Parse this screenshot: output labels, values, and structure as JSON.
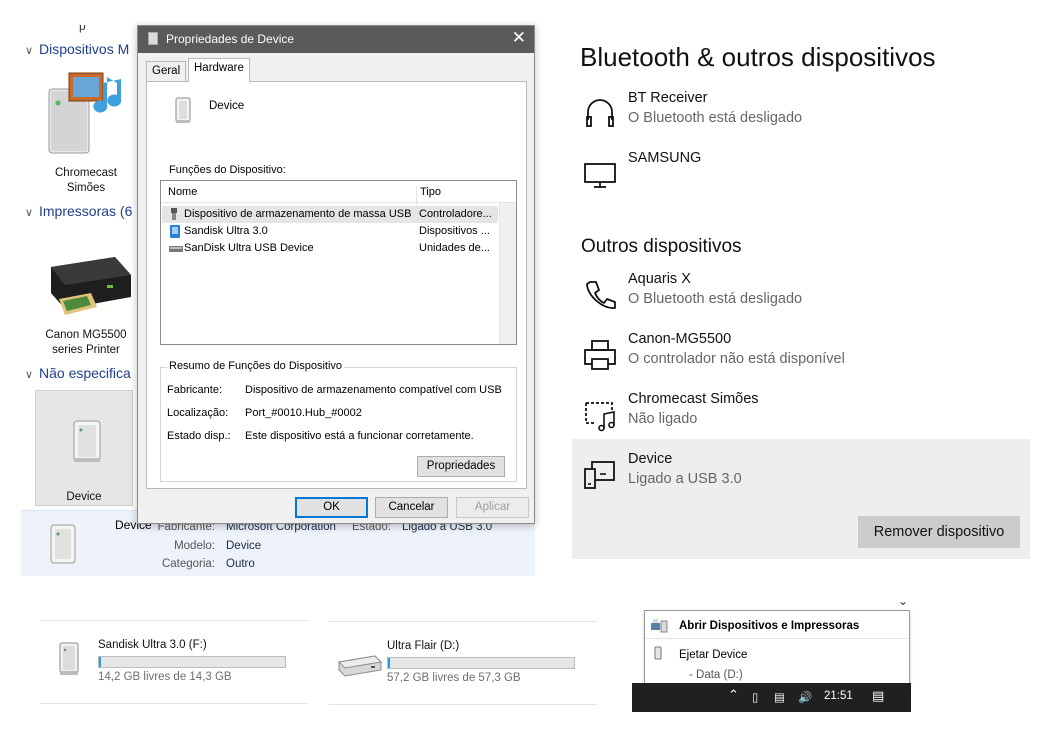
{
  "devices_printers": {
    "top_partial_label": "p",
    "groups": [
      {
        "label": "Dispositivos M"
      },
      {
        "label": "Impressoras (6"
      },
      {
        "label": "Não especifica"
      }
    ],
    "tiles": [
      {
        "label_line1": "Chromecast",
        "label_line2": "Simões"
      },
      {
        "label_line1": "Canon MG5500",
        "label_line2": "series Printer"
      },
      {
        "label_line1": "Device",
        "label_line2": ""
      }
    ],
    "details": {
      "name": "Device",
      "fabricante_key": "Fabricante:",
      "fabricante_value": "Microsoft Corporation",
      "estado_key": "Estado:",
      "estado_value": "Ligado a USB 3.0",
      "modelo_key": "Modelo:",
      "modelo_value": "Device",
      "categoria_key": "Categoria:",
      "categoria_value": "Outro"
    }
  },
  "dialog": {
    "title": "Propriedades de Device",
    "tabs": [
      "Geral",
      "Hardware"
    ],
    "device_name": "Device",
    "functions_label": "Funções do Dispositivo:",
    "columns": [
      "Nome",
      "Tipo"
    ],
    "rows": [
      {
        "name": "Dispositivo de armazenamento de massa USB",
        "type": "Controladore..."
      },
      {
        "name": "Sandisk Ultra 3.0",
        "type": "Dispositivos ..."
      },
      {
        "name": "SanDisk Ultra USB Device",
        "type": "Unidades de..."
      }
    ],
    "summary_title": "Resumo de Funções do Dispositivo",
    "summary": [
      {
        "key": "Fabricante:",
        "value": "Dispositivo de armazenamento compatível com USB"
      },
      {
        "key": "Localização:",
        "value": "Port_#0010.Hub_#0002"
      },
      {
        "key": "Estado disp.:",
        "value": "Este dispositivo está a funcionar corretamente."
      }
    ],
    "properties_button": "Propriedades",
    "ok_button": "OK",
    "cancel_button": "Cancelar",
    "apply_button": "Aplicar"
  },
  "settings": {
    "title": "Bluetooth & outros dispositivos",
    "audio_items": [
      {
        "name": "BT Receiver",
        "status": "O Bluetooth está desligado",
        "icon": "headphones-icon"
      },
      {
        "name": "SAMSUNG",
        "status": "",
        "icon": "monitor-icon"
      }
    ],
    "other_title": "Outros dispositivos",
    "other_items": [
      {
        "name": "Aquaris X",
        "status": "O Bluetooth está desligado",
        "icon": "phone-icon"
      },
      {
        "name": "Canon-MG5500",
        "status": "O controlador não está disponível",
        "icon": "printer-icon"
      },
      {
        "name": "Chromecast Simões",
        "status": "Não ligado",
        "icon": "media-device-icon"
      },
      {
        "name": "Device",
        "status": "Ligado a USB 3.0",
        "icon": "generic-device-icon"
      }
    ],
    "remove_button": "Remover dispositivo"
  },
  "drives": [
    {
      "name": "Sandisk Ultra 3.0 (F:)",
      "free": "14,2 GB livres de 14,3 GB",
      "used_fraction": 0.007
    },
    {
      "name": "Ultra Flair (D:)",
      "free": "57,2 GB livres de 57,3 GB",
      "used_fraction": 0.002
    }
  ],
  "tray": {
    "open_devices": "Abrir Dispositivos e Impressoras",
    "eject": "Ejetar Device",
    "sub_item": "-   Data (D:)",
    "time": "21:51"
  },
  "colors": {
    "accent": "#0078d7",
    "link_blue": "#1e3f8b",
    "selected_bg": "#eeeeee",
    "progress_fill": "#26a0da"
  }
}
